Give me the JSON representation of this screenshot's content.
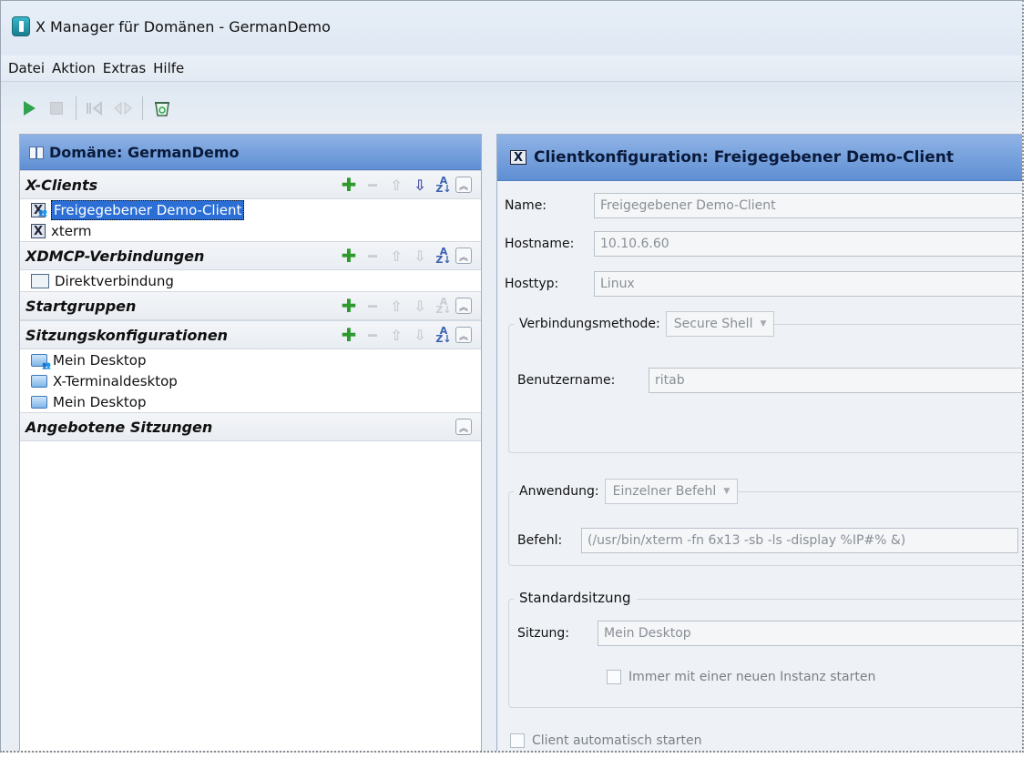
{
  "window": {
    "title": "X Manager für Domänen - GermanDemo"
  },
  "menu": [
    "Datei",
    "Aktion",
    "Extras",
    "Hilfe"
  ],
  "left_pane": {
    "title": "Domäne: GermanDemo",
    "sections": [
      {
        "title": "X-Clients",
        "items": [
          "Freigegebener Demo-Client",
          "xterm"
        ]
      },
      {
        "title": "XDMCP-Verbindungen",
        "items": [
          "Direktverbindung"
        ]
      },
      {
        "title": "Startgruppen",
        "items": []
      },
      {
        "title": "Sitzungskonfigurationen",
        "items": [
          "Mein Desktop",
          "X-Terminaldesktop",
          "Mein Desktop"
        ]
      },
      {
        "title": "Angebotene Sitzungen",
        "items": []
      }
    ]
  },
  "right_pane": {
    "title": "Clientkonfiguration: Freigegebener Demo-Client",
    "name_label": "Name:",
    "name_value": "Freigegebener Demo-Client",
    "hostname_label": "Hostname:",
    "hostname_value": "10.10.6.60",
    "hosttype_label": "Hosttyp:",
    "hosttype_value": "Linux",
    "connection_label": "Verbindungsmethode:",
    "connection_value": "Secure Shell",
    "username_label": "Benutzername:",
    "username_value": "ritab",
    "app_label": "Anwendung:",
    "app_value": "Einzelner Befehl",
    "command_label": "Befehl:",
    "command_value": "(/usr/bin/xterm -fn 6x13 -sb -ls -display %IP#% &)",
    "std_session_legend": "Standardsitzung",
    "session_label": "Sitzung:",
    "session_value": "Mein Desktop",
    "new_instance_label": "Immer mit einer neuen Instanz starten",
    "autostart_label": "Client automatisch starten"
  }
}
